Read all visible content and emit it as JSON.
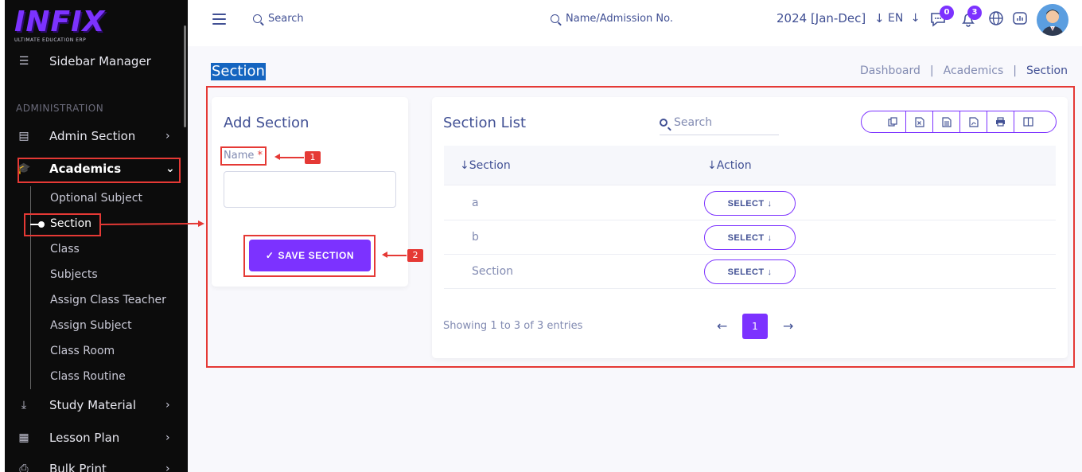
{
  "logo": {
    "text": "INFIX",
    "subtitle": "ULTIMATE EDUCATION ERP"
  },
  "sidebar": {
    "partial_item": "Sidebar Manager",
    "section_heading": "ADMINISTRATION",
    "items": [
      {
        "label": "Admin Section",
        "icon": "admin-icon"
      },
      {
        "label": "Academics",
        "icon": "graduation-cap-icon"
      },
      {
        "label": "Study Material",
        "icon": "download-icon"
      },
      {
        "label": "Lesson Plan",
        "icon": "list-icon"
      },
      {
        "label": "Bulk Print",
        "icon": "print-icon"
      }
    ],
    "sub_items": [
      "Optional Subject",
      "Section",
      "Class",
      "Subjects",
      "Assign Class Teacher",
      "Assign Subject",
      "Class Room",
      "Class Routine"
    ]
  },
  "header": {
    "search_label": "Search",
    "name_search_label": "Name/Admission No.",
    "year": "2024 [Jan-Dec]",
    "language": "EN",
    "chat_badge": "0",
    "notification_badge": "3"
  },
  "page": {
    "title": "Section",
    "breadcrumb": [
      "Dashboard",
      "Academics",
      "Section"
    ]
  },
  "add_section": {
    "title": "Add Section",
    "name_label": "Name",
    "required_mark": "*",
    "name_value": "",
    "save_label": "SAVE SECTION"
  },
  "section_list": {
    "title": "Section List",
    "search_placeholder": "Search",
    "columns": [
      "Section",
      "Action"
    ],
    "rows": [
      {
        "section": "a",
        "action": "SELECT"
      },
      {
        "section": "b",
        "action": "SELECT"
      },
      {
        "section": "Section",
        "action": "SELECT"
      }
    ],
    "showing_text": "Showing 1 to 3 of 3 entries",
    "current_page": "1"
  },
  "annotations": [
    "1",
    "2"
  ],
  "colors": {
    "accent": "#7c32ff",
    "annotation": "#e53935",
    "text": "#415094"
  }
}
